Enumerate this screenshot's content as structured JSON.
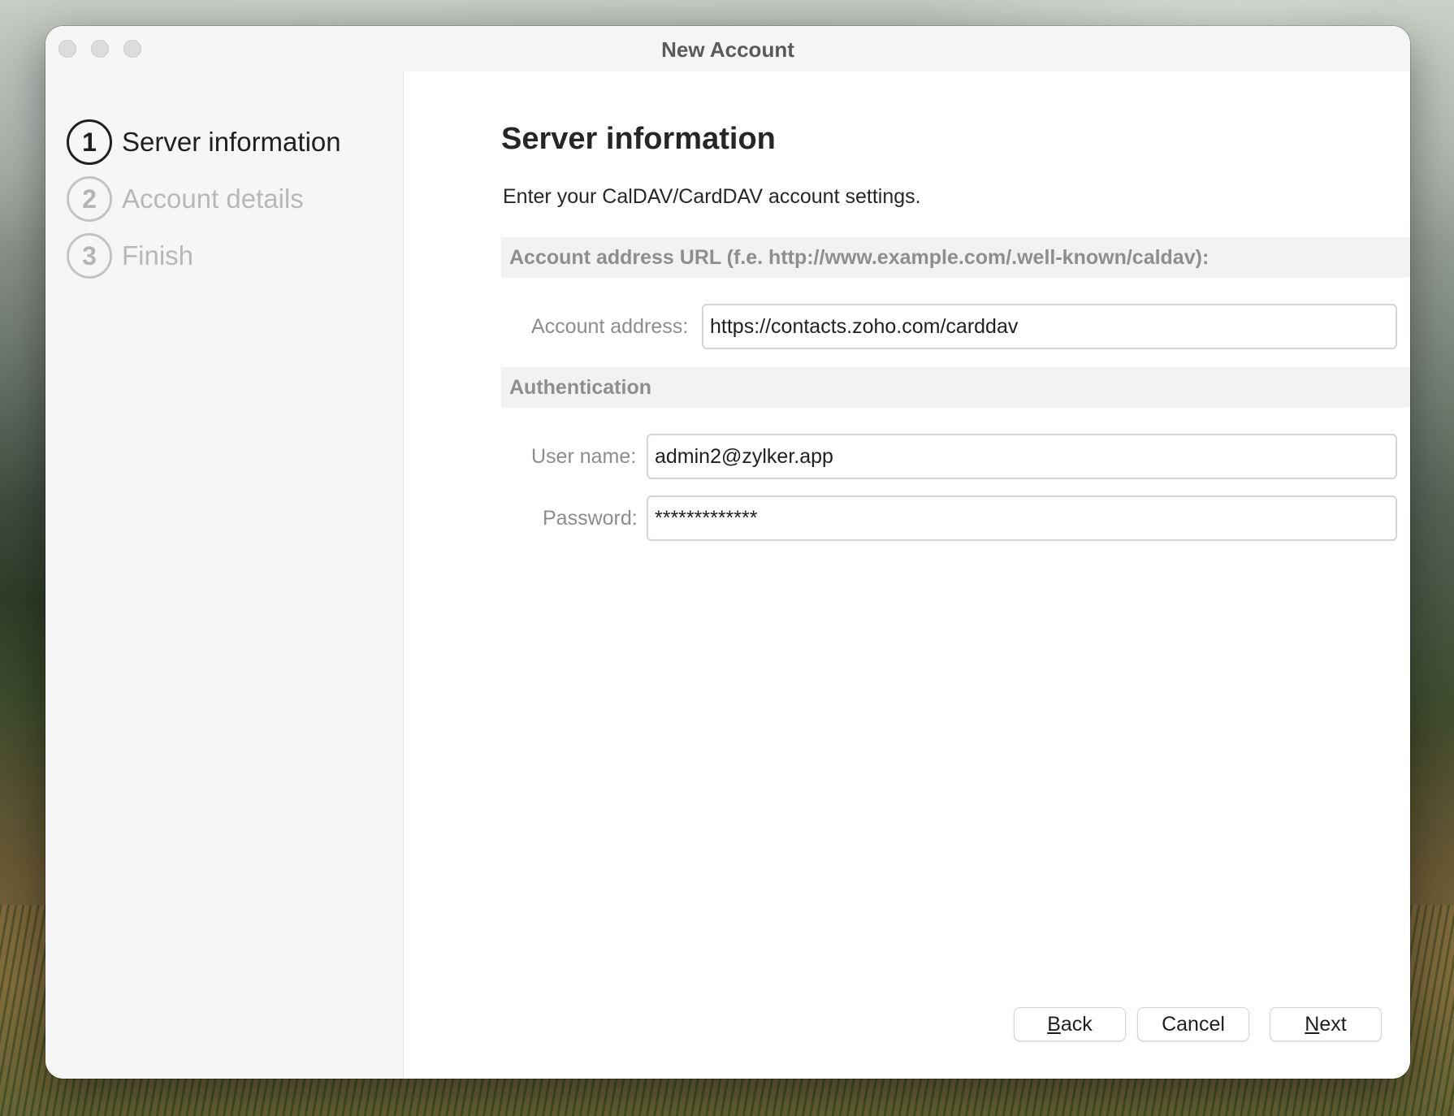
{
  "window": {
    "title": "New Account"
  },
  "steps": [
    {
      "number": "1",
      "label": "Server information",
      "state": "active"
    },
    {
      "number": "2",
      "label": "Account details",
      "state": "inactive"
    },
    {
      "number": "3",
      "label": "Finish",
      "state": "inactive"
    }
  ],
  "main": {
    "heading": "Server information",
    "description": "Enter your CalDAV/CardDAV account settings.",
    "url_section": {
      "header": "Account address URL (f.e. http://www.example.com/.well-known/caldav):",
      "address_label": "Account address:",
      "address_value": "https://contacts.zoho.com/carddav"
    },
    "auth_section": {
      "header": "Authentication",
      "username_label": "User name:",
      "username_value": "admin2@zylker.app",
      "password_label": "Password:",
      "password_value": "*************"
    }
  },
  "buttons": {
    "back": {
      "mnemonic": "B",
      "rest": "ack"
    },
    "cancel": "Cancel",
    "next": {
      "mnemonic": "N",
      "rest": "ext"
    }
  },
  "colors": {
    "active_text": "#1f1f1f",
    "inactive_text": "#b8b8b8",
    "section_header_bg": "#f2f2f2"
  }
}
